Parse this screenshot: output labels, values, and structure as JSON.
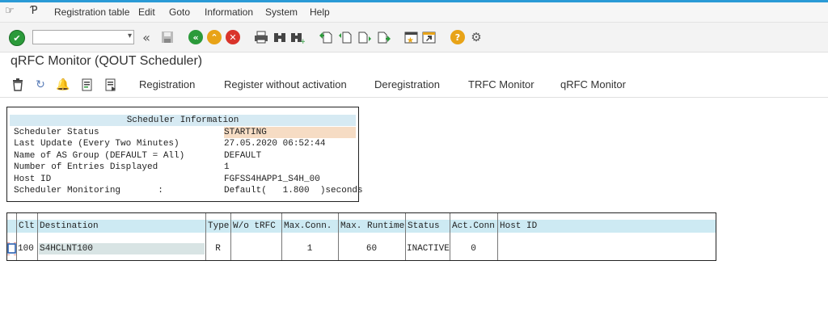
{
  "menu": {
    "items": [
      "Registration table",
      "Edit",
      "Goto",
      "Information",
      "System",
      "Help"
    ]
  },
  "toolbar": {
    "command_field_value": "",
    "icons": [
      "enter-icon",
      "back-icon",
      "save-icon",
      "back-green-icon",
      "exit-icon",
      "cancel-icon",
      "print-icon",
      "find-icon",
      "find-next-icon",
      "first-page-icon",
      "previous-page-icon",
      "next-page-icon",
      "last-page-icon",
      "create-session-icon",
      "shortcut-icon",
      "help-icon",
      "settings-icon"
    ]
  },
  "title": "qRFC Monitor (QOUT Scheduler)",
  "app_toolbar": {
    "buttons": [
      "Registration",
      "Register without activation",
      "Deregistration",
      "TRFC Monitor",
      "qRFC Monitor"
    ],
    "icons": [
      "delete-icon",
      "refresh-icon",
      "alarm-icon",
      "details-icon",
      "display-icon"
    ]
  },
  "scheduler_info": {
    "header": "Scheduler Information",
    "rows": [
      {
        "label": "Scheduler Status",
        "value": "STARTING"
      },
      {
        "label": "Last Update (Every Two Minutes)",
        "value": "27.05.2020 06:52:44"
      },
      {
        "label": "Name of AS Group (DEFAULT = All)",
        "value": "DEFAULT"
      },
      {
        "label": "Number of Entries Displayed",
        "value": "1"
      },
      {
        "label": "Host ID",
        "value": "FGFSS4HAPP1_S4H_00"
      },
      {
        "label": "Scheduler Monitoring       :",
        "value": "Default(   1.800  )seconds"
      }
    ]
  },
  "grid": {
    "columns": [
      "Clt",
      "Destination",
      "Type",
      "W/o tRFC",
      "Max.Conn.",
      "Max. Runtime",
      "Status",
      "Act.Conn",
      "Host ID"
    ],
    "rows": [
      {
        "clt": "100",
        "destination": "S4HCLNT100",
        "type": "R",
        "wo_trfc": "",
        "max_conn": "1",
        "max_runtime": "60",
        "status": "INACTIVE",
        "act_conn": "0",
        "host_id": ""
      }
    ]
  },
  "colors": {
    "accent": "#2a9ad6",
    "header_bg": "#cdeaf3",
    "highlight": "#f6dcc4",
    "enter_green": "#2b9a3a",
    "exit_orange": "#e8a317",
    "cancel_red": "#d9342b"
  }
}
